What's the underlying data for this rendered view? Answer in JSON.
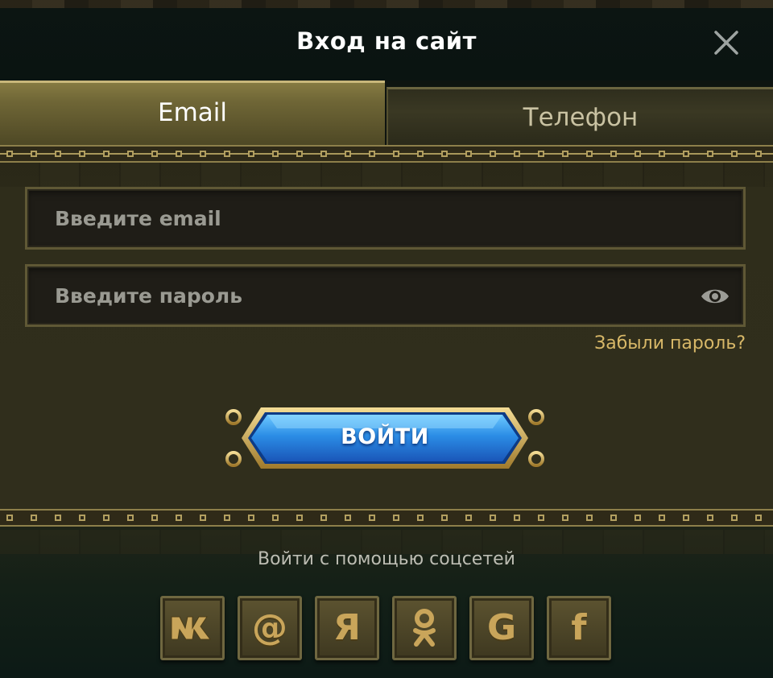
{
  "header": {
    "title": "Вход на сайт"
  },
  "tabs": [
    {
      "label": "Email",
      "active": true
    },
    {
      "label": "Телефон",
      "active": false
    }
  ],
  "form": {
    "email_placeholder": "Введите email",
    "password_placeholder": "Введите пароль",
    "forgot_label": "Забыли пароль?",
    "login_label": "ВОЙТИ"
  },
  "social": {
    "title": "Войти с помощью соцсетей",
    "buttons": [
      {
        "name": "vk",
        "glyph": "vk",
        "icon": "vk-icon"
      },
      {
        "name": "mail",
        "glyph": "@",
        "icon": "at-icon"
      },
      {
        "name": "yandex",
        "glyph": "Я",
        "icon": "yandex-icon"
      },
      {
        "name": "odnoklassniki",
        "glyph": "ok",
        "icon": "odnoklassniki-icon"
      },
      {
        "name": "google",
        "glyph": "G",
        "icon": "google-icon"
      },
      {
        "name": "facebook",
        "glyph": "f",
        "icon": "facebook-icon"
      }
    ]
  },
  "colors": {
    "accent_gold": "#d8b868",
    "button_blue": "#2f8ee8",
    "panel_olive": "#2f2d1b"
  }
}
